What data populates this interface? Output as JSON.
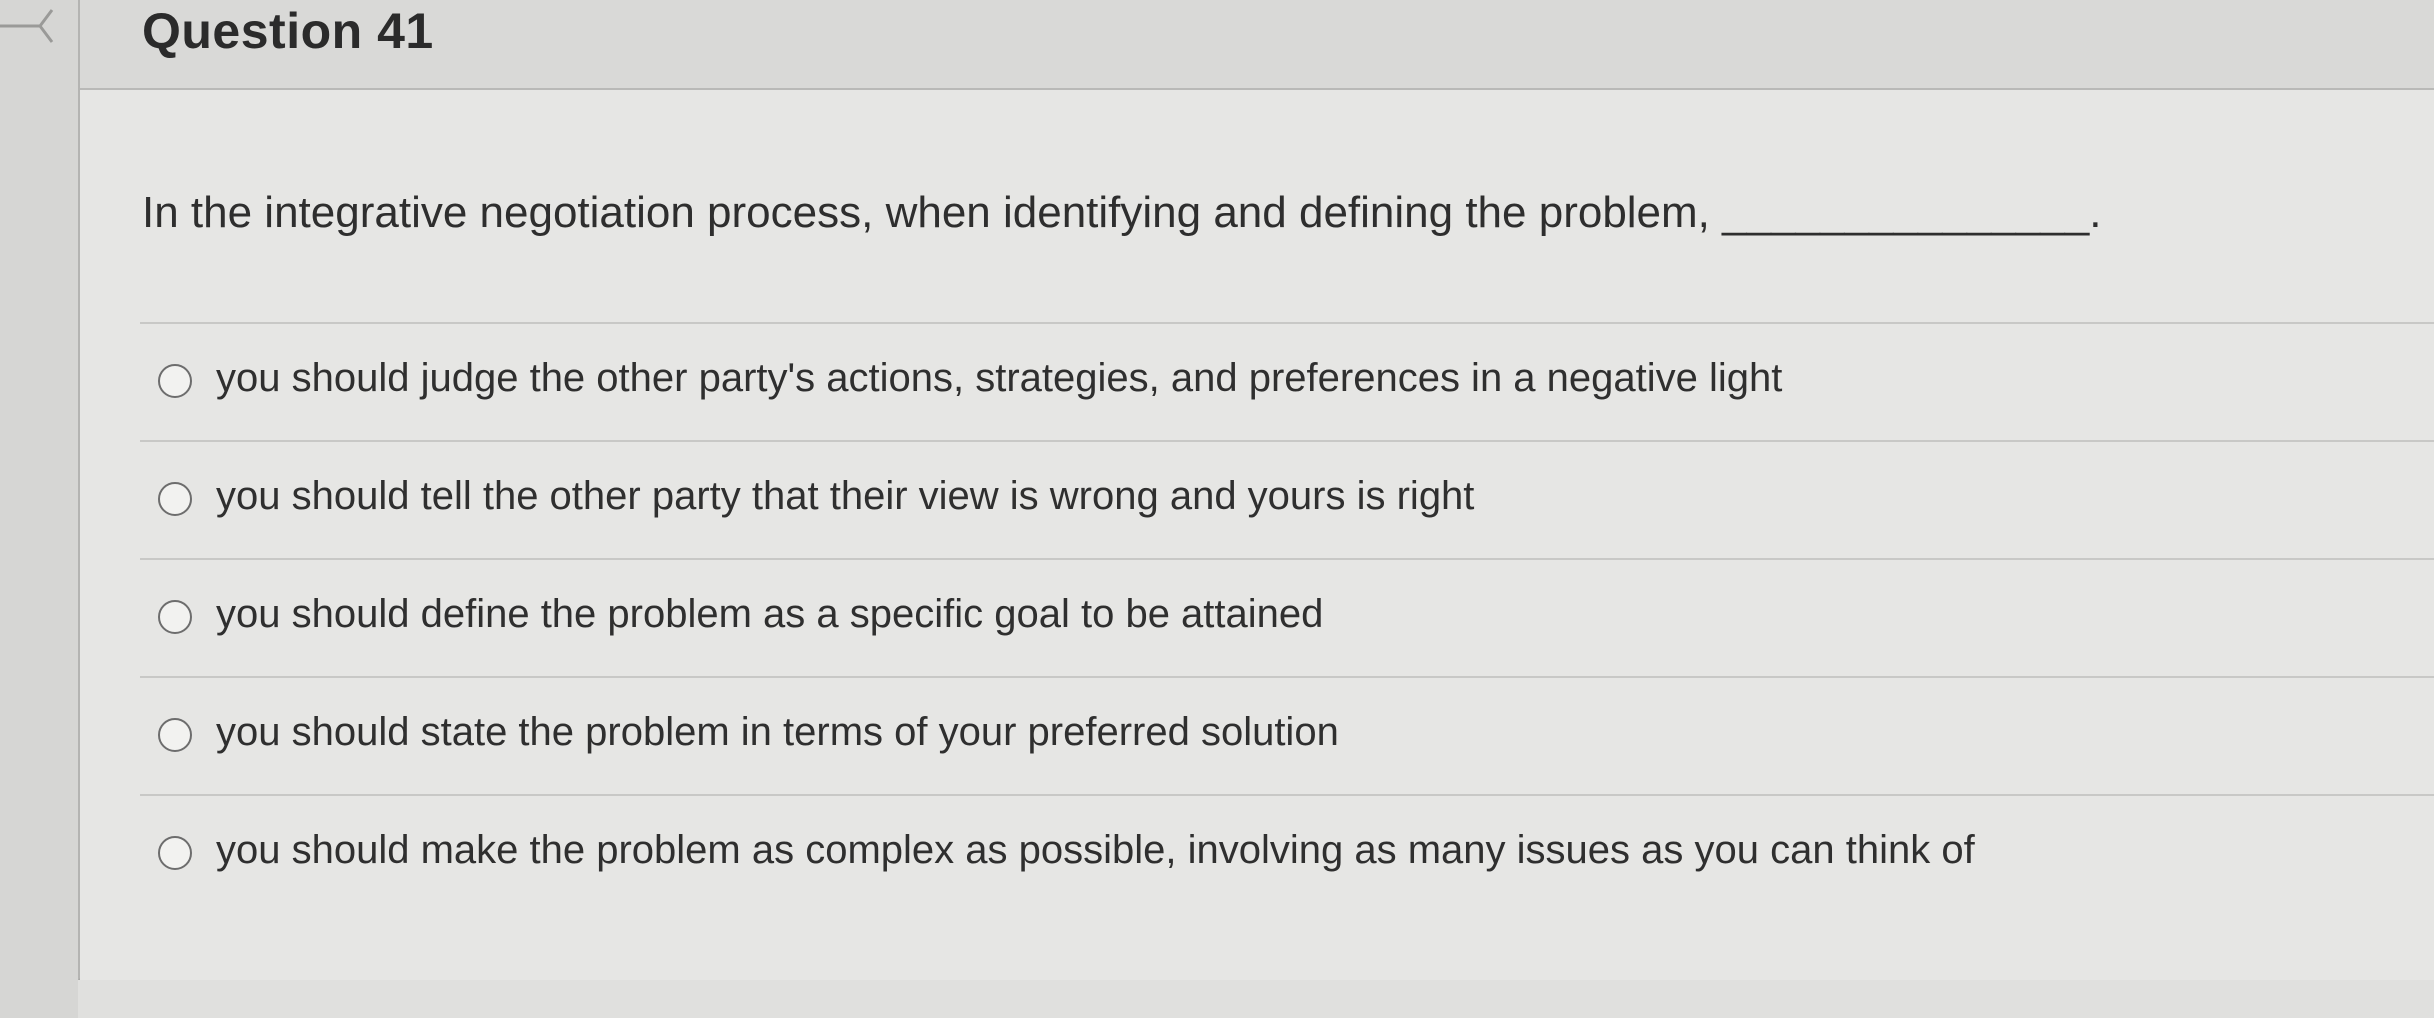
{
  "question": {
    "title": "Question 41",
    "text": "In the integrative negotiation process, when identifying and defining the problem, _______________."
  },
  "answers": [
    {
      "label": "you should judge the other party's actions, strategies, and preferences in a negative light",
      "selected": false
    },
    {
      "label": "you should tell the other party that their view is wrong and yours is right",
      "selected": false
    },
    {
      "label": "you should define the problem as a specific goal to be attained",
      "selected": false
    },
    {
      "label": "you should state the problem in terms of your preferred solution",
      "selected": false
    },
    {
      "label": "you should make the problem as complex as possible, involving as many issues as you can think of",
      "selected": false
    }
  ],
  "icons": {
    "flag": "flag-marker-icon",
    "radio": "radio-button-icon"
  },
  "colors": {
    "background": "#e4e4e2",
    "header": "#d9d9d7",
    "text": "#2e2e2e",
    "divider": "#c8c8c6"
  }
}
